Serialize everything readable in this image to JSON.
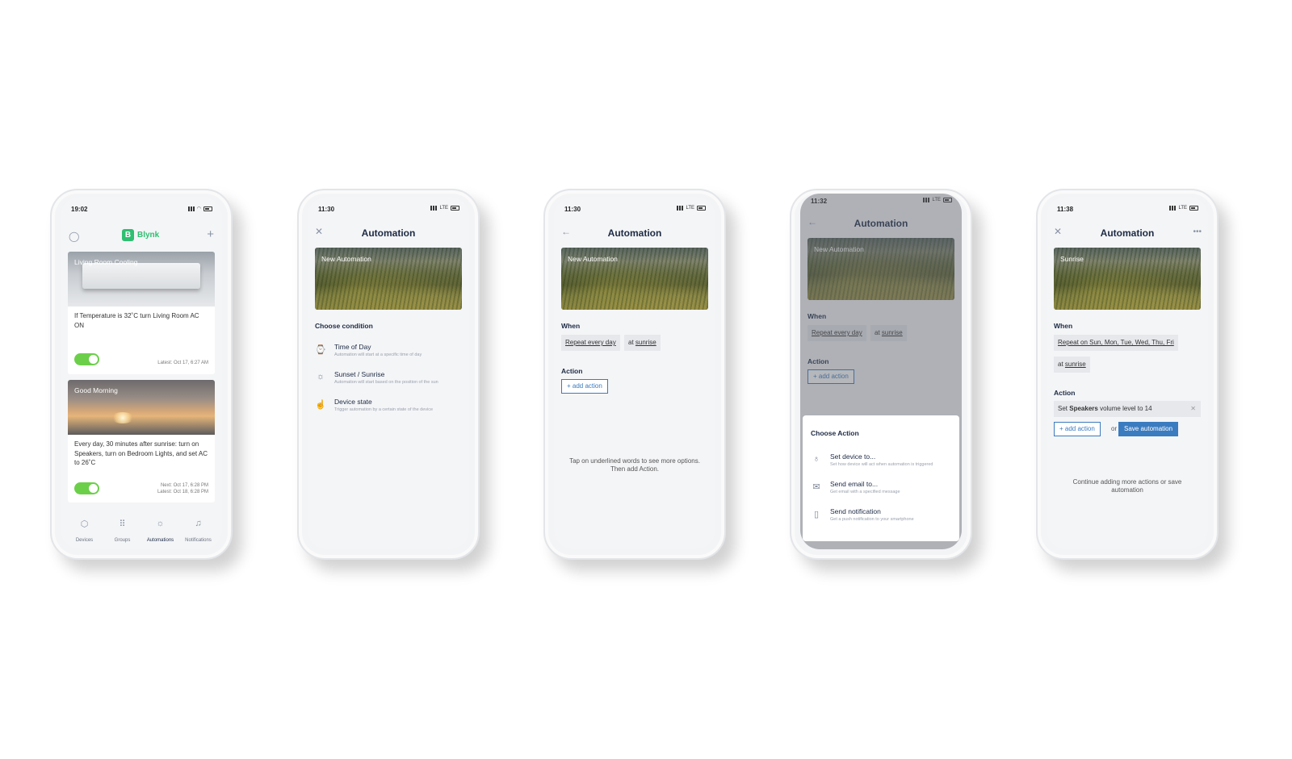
{
  "phone1": {
    "time": "19:02",
    "brand": "Blynk",
    "cards": [
      {
        "title": "Living Room Cooling",
        "text": "If Temperature is 32˚C turn Living Room AC ON",
        "meta": [
          "Latest: Oct 17, 6:27 AM"
        ]
      },
      {
        "title": "Good Morning",
        "text": "Every day, 30 minutes after sunrise: turn on Speakers, turn on Bedroom Lights, and set AC to 26˚C",
        "meta": [
          "Next: Oct 17, 6:28 PM",
          "Latest: Oct 18, 6:28 PM"
        ]
      }
    ],
    "tabs": [
      "Devices",
      "Groups",
      "Automations",
      "Notifications"
    ]
  },
  "phone2": {
    "time": "11:30",
    "net": "LTE",
    "title": "Automation",
    "banner": "New Automation",
    "section": "Choose condition",
    "options": [
      {
        "title": "Time of Day",
        "desc": "Automation will start at a specific time of day"
      },
      {
        "title": "Sunset / Sunrise",
        "desc": "Automation will start based on the position of the sun"
      },
      {
        "title": "Device state",
        "desc": "Trigger automation by a certain state of the device"
      }
    ]
  },
  "phone3": {
    "time": "11:30",
    "net": "LTE",
    "title": "Automation",
    "banner": "New Automation",
    "when": "When",
    "repeat": "Repeat every day",
    "at": "at",
    "sunrise": "sunrise",
    "action": "Action",
    "add": "+ add action",
    "hint": "Tap on underlined words to see more options. Then add Action."
  },
  "phone4": {
    "time": "11:32",
    "net": "LTE",
    "title": "Automation",
    "banner": "New Automation",
    "when": "When",
    "repeat": "Repeat every day",
    "at": "at",
    "sunrise": "sunrise",
    "action": "Action",
    "add": "+ add action",
    "sheet_title": "Choose Action",
    "options": [
      {
        "title": "Set device to...",
        "desc": "Set how device will act when automation is triggered"
      },
      {
        "title": "Send email to...",
        "desc": "Get email with a specified message"
      },
      {
        "title": "Send notification",
        "desc": "Get a push notification to your smartphone"
      }
    ]
  },
  "phone5": {
    "time": "11:38",
    "net": "LTE",
    "title": "Automation",
    "banner": "Sunrise",
    "when": "When",
    "repeat": "Repeat on Sun, Mon, Tue, Wed, Thu, Fri",
    "at": "at",
    "sunrise": "sunrise",
    "action": "Action",
    "action_item": {
      "pre": "Set",
      "device": "Speakers",
      "post": "volume level to 14"
    },
    "add": "+ add action",
    "or": "or",
    "save": "Save automation",
    "hint": "Continue adding more actions or save automation"
  }
}
